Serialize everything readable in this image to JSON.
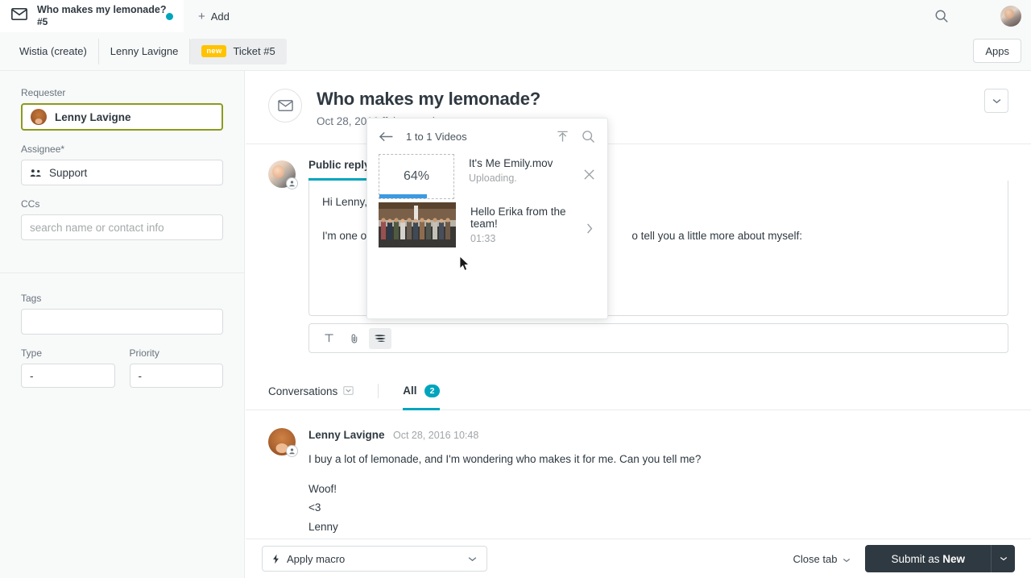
{
  "topbar": {
    "tab_title": "Who makes my lemonade?",
    "tab_number": "#5",
    "add_label": "Add",
    "add_plus": "+",
    "icons": {
      "search": "search-icon",
      "apps_grid": "grid-icon",
      "avatar": "user-avatar"
    }
  },
  "navbar": {
    "crumbs": [
      {
        "label": "Wistia (create)",
        "badge": "",
        "active": false
      },
      {
        "label": "Lenny Lavigne",
        "badge": "",
        "active": false
      },
      {
        "label": "Ticket #5",
        "badge": "new",
        "active": true
      }
    ],
    "apps_button": "Apps",
    "badge_color": "#ffc300"
  },
  "sidebar": {
    "requester": {
      "label": "Requester",
      "value": "Lenny Lavigne",
      "focused": true,
      "focus_color": "#8a9b1e"
    },
    "assignee": {
      "label": "Assignee*",
      "value": "Support"
    },
    "ccs": {
      "label": "CCs",
      "value": "",
      "placeholder": "search name or contact info"
    },
    "tags": {
      "label": "Tags",
      "value": ""
    },
    "type": {
      "label": "Type",
      "value": "-"
    },
    "priority": {
      "label": "Priority",
      "value": "-"
    }
  },
  "ticket": {
    "title": "Who makes my lemonade?",
    "meta": "Oct 28, 2016                         ffslemonade.com",
    "caret_icon": "chevron-down-icon"
  },
  "composer": {
    "tab_label": "Public reply",
    "tab_accent": "#00a5bd",
    "line1": "Hi Lenny,",
    "line2_left": "I'm one of",
    "line2_right": "o tell you a little more about myself:",
    "toolbar": [
      {
        "name": "text-format-icon",
        "glyph": "T",
        "active": false
      },
      {
        "name": "attachment-icon",
        "glyph": "paperclip",
        "active": false
      },
      {
        "name": "wistia-icon",
        "glyph": "wistia",
        "active": true
      }
    ]
  },
  "video_popup": {
    "header_title": "1 to 1 Videos",
    "back_icon": "arrow-left-icon",
    "upload_icon": "upload-icon",
    "search_icon": "search-icon",
    "items": [
      {
        "name": "It's Me Emily.mov",
        "status": "Uploading.",
        "progress_label": "64%",
        "progress": 64,
        "progress_color": "#3b9ae1",
        "close_icon": "close-icon",
        "type": "uploading"
      },
      {
        "name": "Hello Erika from the team!",
        "duration": "01:33",
        "chevron_icon": "chevron-right-icon",
        "type": "video"
      }
    ]
  },
  "conversations": {
    "left_label": "Conversations",
    "left_icon": "filter-collapse-icon",
    "all_label": "All",
    "all_count": "2",
    "accent": "#00a5bd"
  },
  "message": {
    "author": "Lenny Lavigne",
    "time": "Oct 28, 2016 10:48",
    "paragraph": "I buy a lot of lemonade, and I'm wondering who makes it for me. Can you tell me?",
    "sign1": "Woof!",
    "sign2": "<3",
    "sign3": "Lenny"
  },
  "footer": {
    "macro_label": "Apply macro",
    "macro_icon": "bolt-icon",
    "macro_caret": "chevron-down-icon",
    "close_tab_label": "Close tab",
    "close_tab_caret": "chevron-down-icon",
    "submit_prefix": "Submit as ",
    "submit_state": "New",
    "submit_caret": "chevron-down-icon",
    "submit_bg": "#2f3941"
  }
}
